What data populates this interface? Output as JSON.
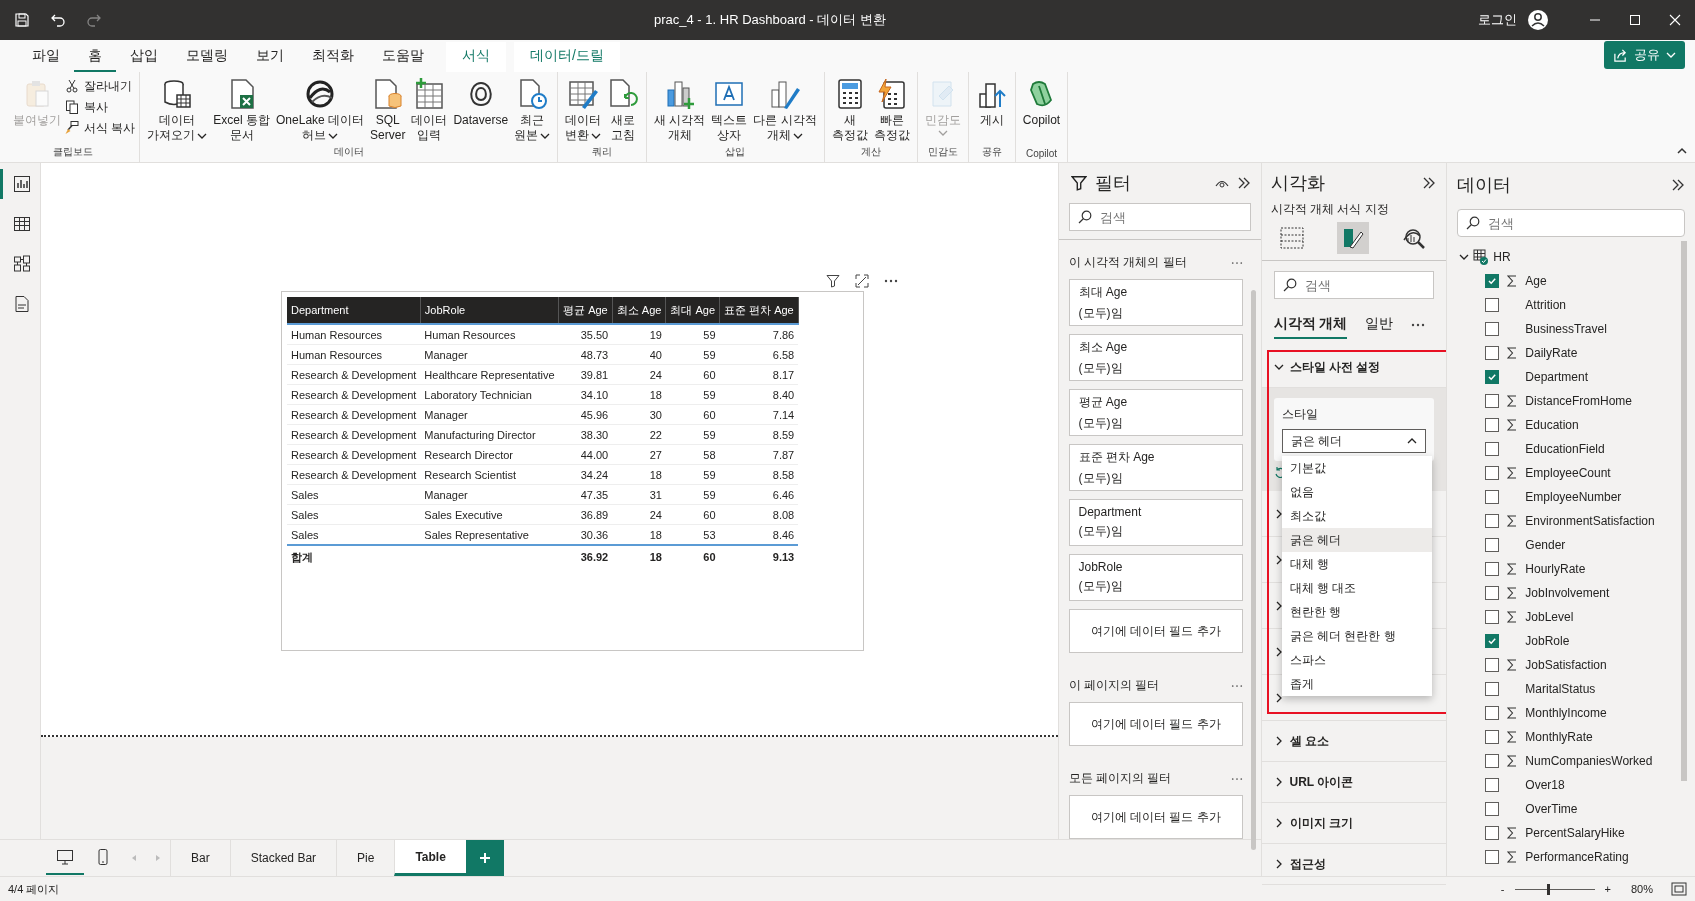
{
  "title_bar": {
    "title": "prac_4 - 1. HR Dashboard - 데이터 변환",
    "sign_in": "로그인",
    "quick_access": [
      {
        "disabled": false
      },
      {
        "disabled": false
      },
      {
        "disabled": true
      }
    ]
  },
  "menu_tabs": [
    {
      "label": "파일",
      "kind": "normal",
      "selected": false
    },
    {
      "label": "홈",
      "kind": "normal",
      "selected": true
    },
    {
      "label": "삽입",
      "kind": "normal",
      "selected": false
    },
    {
      "label": "모델링",
      "kind": "normal",
      "selected": false
    },
    {
      "label": "보기",
      "kind": "normal",
      "selected": false
    },
    {
      "label": "최적화",
      "kind": "normal",
      "selected": false
    },
    {
      "label": "도움말",
      "kind": "normal",
      "selected": false
    },
    {
      "label": "서식",
      "kind": "contextual",
      "selected": false
    },
    {
      "label": "데이터/드릴",
      "kind": "contextual",
      "selected": false
    }
  ],
  "share_button": "공유",
  "ribbon": [
    {
      "label": "클립보드",
      "buttons": [
        {
          "kind": "large",
          "lines": [
            "붙여넣기"
          ],
          "disabled": true,
          "menu": false
        },
        {
          "kind": "small",
          "lines": [
            "잘라내기"
          ],
          "disabled": false,
          "menu": false
        },
        {
          "kind": "small",
          "lines": [
            "복사"
          ],
          "disabled": false,
          "menu": false
        },
        {
          "kind": "small",
          "lines": [
            "서식 복사"
          ],
          "disabled": false,
          "menu": false
        }
      ]
    },
    {
      "label": "데이터",
      "buttons": [
        {
          "kind": "large",
          "lines": [
            "데이터",
            "가져오기"
          ],
          "disabled": false,
          "menu": true
        },
        {
          "kind": "large",
          "lines": [
            "Excel 통합",
            "문서"
          ],
          "disabled": false,
          "menu": false
        },
        {
          "kind": "large",
          "lines": [
            "OneLake 데이터",
            "허브"
          ],
          "disabled": false,
          "menu": true
        },
        {
          "kind": "large",
          "lines": [
            "SQL",
            "Server"
          ],
          "disabled": false,
          "menu": false
        },
        {
          "kind": "large",
          "lines": [
            "데이터",
            "입력"
          ],
          "disabled": false,
          "menu": false
        },
        {
          "kind": "large",
          "lines": [
            "Dataverse"
          ],
          "disabled": false,
          "menu": false
        },
        {
          "kind": "large",
          "lines": [
            "최근",
            "원본"
          ],
          "disabled": false,
          "menu": true
        }
      ]
    },
    {
      "label": "쿼리",
      "buttons": [
        {
          "kind": "large",
          "lines": [
            "데이터",
            "변환"
          ],
          "disabled": false,
          "menu": true
        },
        {
          "kind": "large",
          "lines": [
            "새로",
            "고침"
          ],
          "disabled": false,
          "menu": false
        }
      ]
    },
    {
      "label": "삽입",
      "buttons": [
        {
          "kind": "large",
          "lines": [
            "새 시각적",
            "개체"
          ],
          "disabled": false,
          "menu": false
        },
        {
          "kind": "large",
          "lines": [
            "텍스트",
            "상자"
          ],
          "disabled": false,
          "menu": false
        },
        {
          "kind": "large",
          "lines": [
            "다른 시각적",
            "개체"
          ],
          "disabled": false,
          "menu": true
        }
      ]
    },
    {
      "label": "계산",
      "buttons": [
        {
          "kind": "large",
          "lines": [
            "새",
            "측정값"
          ],
          "disabled": false,
          "menu": false
        },
        {
          "kind": "large",
          "lines": [
            "빠른",
            "측정값"
          ],
          "disabled": false,
          "menu": false
        }
      ]
    },
    {
      "label": "민감도",
      "buttons": [
        {
          "kind": "large",
          "lines": [
            "민감도"
          ],
          "disabled": true,
          "menu": true
        }
      ]
    },
    {
      "label": "공유",
      "buttons": [
        {
          "kind": "large",
          "lines": [
            "게시"
          ],
          "disabled": false,
          "menu": false
        }
      ]
    },
    {
      "label": "Copilot",
      "buttons": [
        {
          "kind": "large",
          "lines": [
            "Copilot"
          ],
          "disabled": false,
          "menu": false
        }
      ]
    }
  ],
  "left_rail": [
    {
      "selected": true
    },
    {
      "selected": false
    },
    {
      "selected": false
    },
    {
      "selected": false
    }
  ],
  "table": {
    "columns": [
      {
        "label": "Department"
      },
      {
        "label": "JobRole"
      },
      {
        "label": "평균 Age"
      },
      {
        "label": "최소 Age"
      },
      {
        "label": "최대 Age"
      },
      {
        "label": "표준 편차 Age"
      }
    ],
    "rows": [
      [
        "Human Resources",
        "Human Resources",
        "35.50",
        "19",
        "59",
        "7.86"
      ],
      [
        "Human Resources",
        "Manager",
        "48.73",
        "40",
        "59",
        "6.58"
      ],
      [
        "Research & Development",
        "Healthcare Representative",
        "39.81",
        "24",
        "60",
        "8.17"
      ],
      [
        "Research & Development",
        "Laboratory Technician",
        "34.10",
        "18",
        "59",
        "8.40"
      ],
      [
        "Research & Development",
        "Manager",
        "45.96",
        "30",
        "60",
        "7.14"
      ],
      [
        "Research & Development",
        "Manufacturing Director",
        "38.30",
        "22",
        "59",
        "8.59"
      ],
      [
        "Research & Development",
        "Research Director",
        "44.00",
        "27",
        "58",
        "7.87"
      ],
      [
        "Research & Development",
        "Research Scientist",
        "34.24",
        "18",
        "59",
        "8.58"
      ],
      [
        "Sales",
        "Manager",
        "47.35",
        "31",
        "59",
        "6.46"
      ],
      [
        "Sales",
        "Sales Executive",
        "36.89",
        "24",
        "60",
        "8.08"
      ],
      [
        "Sales",
        "Sales Representative",
        "30.36",
        "18",
        "53",
        "8.46"
      ]
    ],
    "total": {
      "label": "합계",
      "values": [
        "36.92",
        "18",
        "60",
        "9.13"
      ]
    }
  },
  "filters": {
    "title": "필터",
    "search_placeholder": "검색",
    "sections": [
      {
        "title": "이 시각적 개체의 필터",
        "cards": [
          {
            "field": "최대 Age",
            "state": "(모두)임"
          },
          {
            "field": "최소 Age",
            "state": "(모두)임"
          },
          {
            "field": "평균 Age",
            "state": "(모두)임"
          },
          {
            "field": "표준 편차 Age",
            "state": "(모두)임"
          },
          {
            "field": "Department",
            "state": "(모두)임"
          },
          {
            "field": "JobRole",
            "state": "(모두)임"
          }
        ],
        "add_label": "여기에 데이터 필드 추가"
      },
      {
        "title": "이 페이지의 필터",
        "add_label": "여기에 데이터 필드 추가"
      },
      {
        "title": "모든 페이지의 필터",
        "add_label": "여기에 데이터 필드 추가"
      }
    ]
  },
  "visualizations": {
    "title": "시각화",
    "subtitle": "시각적 개체 서식 지정",
    "modes": [
      {
        "selected": false
      },
      {
        "selected": true
      },
      {
        "selected": false
      }
    ],
    "search_placeholder": "검색",
    "tabs": [
      {
        "label": "시각적 개체",
        "selected": true
      },
      {
        "label": "일반",
        "selected": false
      }
    ],
    "sections": [
      {
        "label": "스타일 사전 설정",
        "expanded": true
      },
      {
        "label": "셀 요소",
        "expanded": false
      },
      {
        "label": "URL 아이콘",
        "expanded": false
      },
      {
        "label": "이미지 크기",
        "expanded": false
      },
      {
        "label": "접근성",
        "expanded": false
      }
    ],
    "style_card": {
      "label": "스타일",
      "value": "굵은 헤더",
      "open": true,
      "options": [
        {
          "label": "기본값",
          "selected": false
        },
        {
          "label": "없음",
          "selected": false
        },
        {
          "label": "최소값",
          "selected": false
        },
        {
          "label": "굵은 헤더",
          "selected": true
        },
        {
          "label": "대체 행",
          "selected": false
        },
        {
          "label": "대체 행 대조",
          "selected": false
        },
        {
          "label": "현란한 행",
          "selected": false
        },
        {
          "label": "굵은 헤더 현란한 행",
          "selected": false
        },
        {
          "label": "스파스",
          "selected": false
        },
        {
          "label": "좁게",
          "selected": false
        }
      ]
    }
  },
  "data": {
    "title": "데이터",
    "search_placeholder": "검색",
    "tree": [
      {
        "label": "HR",
        "expanded": true,
        "children": [
          {
            "label": "Age",
            "checked": true,
            "aggregate": true
          },
          {
            "label": "Attrition",
            "checked": false,
            "aggregate": false
          },
          {
            "label": "BusinessTravel",
            "checked": false,
            "aggregate": false
          },
          {
            "label": "DailyRate",
            "checked": false,
            "aggregate": true
          },
          {
            "label": "Department",
            "checked": true,
            "aggregate": false
          },
          {
            "label": "DistanceFromHome",
            "checked": false,
            "aggregate": true
          },
          {
            "label": "Education",
            "checked": false,
            "aggregate": true
          },
          {
            "label": "EducationField",
            "checked": false,
            "aggregate": false
          },
          {
            "label": "EmployeeCount",
            "checked": false,
            "aggregate": true
          },
          {
            "label": "EmployeeNumber",
            "checked": false,
            "aggregate": false
          },
          {
            "label": "EnvironmentSatisfaction",
            "checked": false,
            "aggregate": true
          },
          {
            "label": "Gender",
            "checked": false,
            "aggregate": false
          },
          {
            "label": "HourlyRate",
            "checked": false,
            "aggregate": true
          },
          {
            "label": "JobInvolvement",
            "checked": false,
            "aggregate": true
          },
          {
            "label": "JobLevel",
            "checked": false,
            "aggregate": true
          },
          {
            "label": "JobRole",
            "checked": true,
            "aggregate": false
          },
          {
            "label": "JobSatisfaction",
            "checked": false,
            "aggregate": true
          },
          {
            "label": "MaritalStatus",
            "checked": false,
            "aggregate": false
          },
          {
            "label": "MonthlyIncome",
            "checked": false,
            "aggregate": true
          },
          {
            "label": "MonthlyRate",
            "checked": false,
            "aggregate": true
          },
          {
            "label": "NumCompaniesWorked",
            "checked": false,
            "aggregate": true
          },
          {
            "label": "Over18",
            "checked": false,
            "aggregate": false
          },
          {
            "label": "OverTime",
            "checked": false,
            "aggregate": false
          },
          {
            "label": "PercentSalaryHike",
            "checked": false,
            "aggregate": true
          },
          {
            "label": "PerformanceRating",
            "checked": false,
            "aggregate": true
          }
        ]
      }
    ]
  },
  "views": [
    {
      "selected": true
    },
    {
      "selected": false
    }
  ],
  "page_tabs": [
    {
      "label": "Bar",
      "selected": false
    },
    {
      "label": "Stacked Bar",
      "selected": false
    },
    {
      "label": "Pie",
      "selected": false
    },
    {
      "label": "Table",
      "selected": true
    }
  ],
  "status_bar": {
    "page": "4/4 페이지",
    "zoom_minus": "-",
    "zoom_plus": "+",
    "zoom": "80%",
    "level": 0.4
  }
}
